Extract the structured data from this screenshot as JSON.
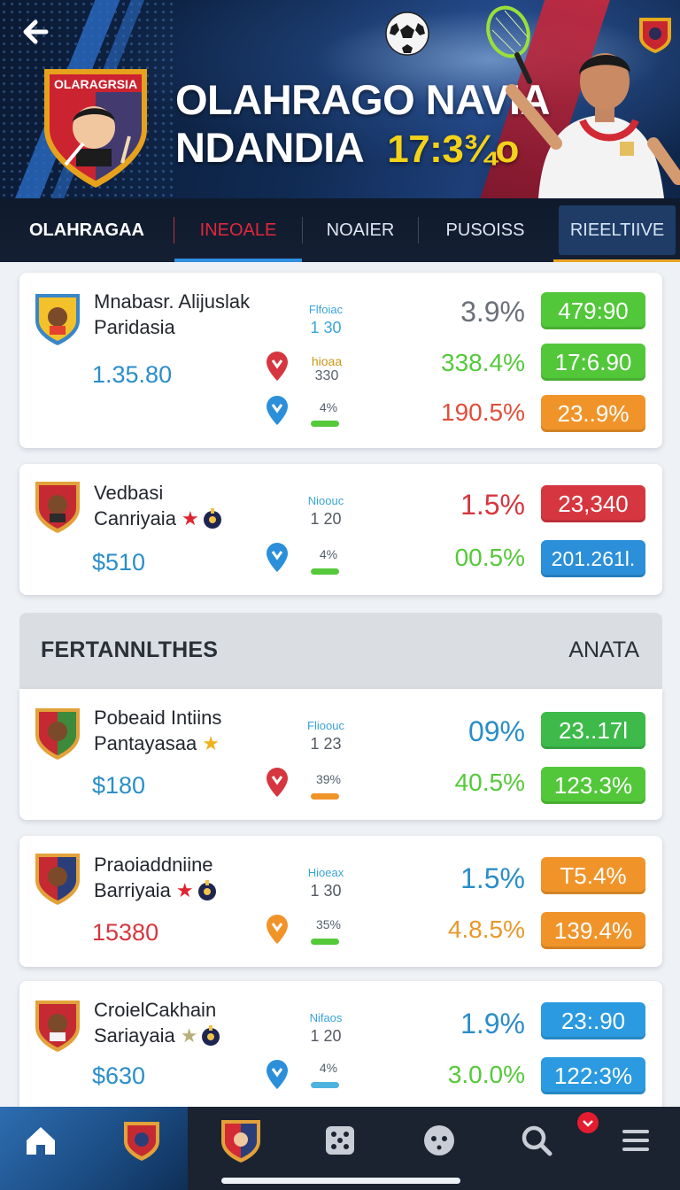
{
  "hero": {
    "club_name": "OLARAGRSIA",
    "title_line1": "OLAHRAGO NAVIA",
    "title_line2": "NDANDIA",
    "score": "17:3¾o"
  },
  "tabs": [
    {
      "label": "OLAHRAGAA"
    },
    {
      "label": "INEOALE"
    },
    {
      "label": "NOAIER"
    },
    {
      "label": "PUSOISS"
    },
    {
      "label": "RIEELTIIVE"
    }
  ],
  "cards": [
    {
      "name_line1": "Mnabasr. Alijuslak",
      "name_line2": "Paridasia",
      "price": "1.35.80",
      "meta_head": "Flfoiac",
      "meta_val": "1 30",
      "mini_label": "hioaa",
      "mini_val": "330",
      "small_pct": "4%",
      "rows": [
        {
          "pct": "3.9%",
          "chip": "479:90"
        },
        {
          "pct": "338.4%",
          "chip": "17:6.90"
        },
        {
          "pct": "190.5%",
          "chip": "23..9%"
        }
      ]
    },
    {
      "name_line1": "Vedbasi",
      "name_line2": "Canriyaia",
      "price": "$510",
      "meta_head": "Nioouc",
      "meta_val": "1 20",
      "small_pct": "4%",
      "rows": [
        {
          "pct": "1.5%",
          "chip": "23,340"
        },
        {
          "pct": "00.5%",
          "chip": "201.261l."
        }
      ]
    },
    {
      "name_line1": "Pobeaid Intiins",
      "name_line2": "Pantayasaa",
      "price": "$180",
      "meta_head": "Flioouc",
      "meta_val": "1 23",
      "small_pct": "39%",
      "rows": [
        {
          "pct": "09%",
          "chip": "23..17l"
        },
        {
          "pct": "40.5%",
          "chip": "123.3%"
        }
      ]
    },
    {
      "name_line1": "Praoiaddniine",
      "name_line2": "Barriyaia",
      "price": "15380",
      "meta_head": "Hioeax",
      "meta_val": "1 30",
      "small_pct": "35%",
      "rows": [
        {
          "pct": "1.5%",
          "chip": "T5.4%"
        },
        {
          "pct": "4.8.5%",
          "chip": "139.4%"
        }
      ]
    },
    {
      "name_line1": "CroielCakhain",
      "name_line2": "Sariayaia",
      "price": "$630",
      "meta_head": "Nifaos",
      "meta_val": "1 20",
      "small_pct": "4%",
      "rows": [
        {
          "pct": "1.9%",
          "chip": "23:.90"
        },
        {
          "pct": "3.0.0%",
          "chip": "122:3%"
        }
      ]
    }
  ],
  "section": {
    "left": "FERTANNLTHES",
    "right": "ANATA"
  },
  "colors": {
    "green": "#55c93a",
    "orange": "#f0942a",
    "red": "#d6363f",
    "blue": "#2b8fd9",
    "teal_text": "#2a8ec9"
  },
  "icons": [
    "back-arrow-icon",
    "home-icon",
    "crest-icon",
    "grid-icon",
    "face-icon",
    "search-icon",
    "menu-icon"
  ]
}
